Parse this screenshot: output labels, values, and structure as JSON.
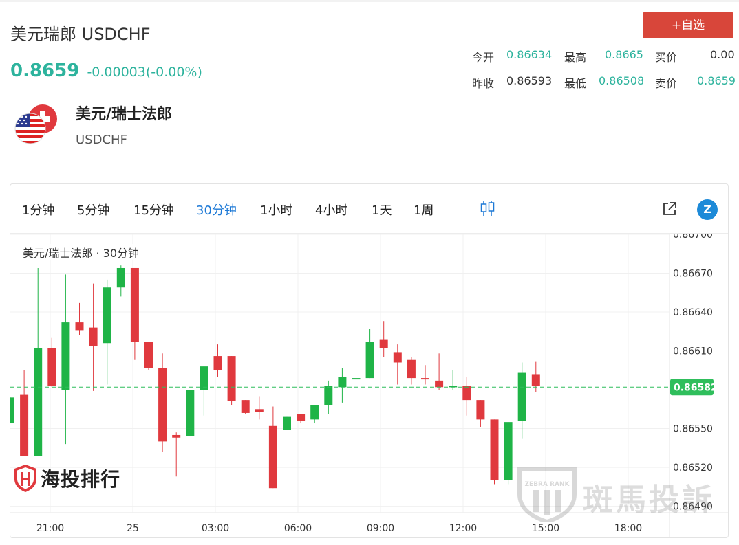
{
  "header": {
    "title": "美元瑞郎 USDCHF",
    "price": "0.8659",
    "change": "-0.00003(-0.00%)",
    "watch_button": "+自选"
  },
  "quote": {
    "open_label": "今开",
    "open_value": "0.86634",
    "high_label": "最高",
    "high_value": "0.8665",
    "bid_label": "买价",
    "bid_value": "0.00",
    "prev_close_label": "昨收",
    "prev_close_value": "0.86593",
    "low_label": "最低",
    "low_value": "0.86508",
    "ask_label": "卖价",
    "ask_value": "0.8659"
  },
  "instrument": {
    "name": "美元/瑞士法郎",
    "code": "USDCHF",
    "icon": "usd-chf-flag-icon"
  },
  "toolbar": {
    "timeframes": [
      "1分钟",
      "5分钟",
      "15分钟",
      "30分钟",
      "1小时",
      "4小时",
      "1天",
      "1周"
    ],
    "active_timeframe": "30分钟",
    "icons": [
      "candlestick-type-icon",
      "popout-icon",
      "z-brand-icon"
    ]
  },
  "chart": {
    "legend": "美元/瑞士法郎 · 30分钟",
    "current_price_label": "0.86582",
    "watermark_left": "海投排行",
    "watermark_right": "斑馬投訴",
    "watermark_right_badge": "ZEBRA RANK"
  },
  "colors": {
    "up": "#1fb447",
    "down": "#e0393e",
    "accent_green": "#2db39d",
    "active_blue": "#1d79d6",
    "button_red": "#d8463a"
  },
  "chart_data": {
    "type": "candlestick",
    "x_tick_labels": [
      "21:00",
      "25",
      "03:00",
      "06:00",
      "09:00",
      "12:00",
      "15:00",
      "18:00"
    ],
    "y_tick_labels": [
      "0.86700",
      "0.86670",
      "0.86640",
      "0.86610",
      "0.86550",
      "0.86520",
      "0.86490"
    ],
    "ylim": [
      0.86485,
      0.867
    ],
    "current_price": 0.86582,
    "grid": true,
    "candles": [
      {
        "o": 0.86554,
        "h": 0.86574,
        "l": 0.86554,
        "c": 0.86574
      },
      {
        "o": 0.86576,
        "h": 0.86595,
        "l": 0.86533,
        "c": 0.86529
      },
      {
        "o": 0.86529,
        "h": 0.86674,
        "l": 0.86529,
        "c": 0.86612
      },
      {
        "o": 0.86612,
        "h": 0.8662,
        "l": 0.86582,
        "c": 0.86583
      },
      {
        "o": 0.8658,
        "h": 0.86669,
        "l": 0.86538,
        "c": 0.86632
      },
      {
        "o": 0.86632,
        "h": 0.86647,
        "l": 0.86622,
        "c": 0.86626
      },
      {
        "o": 0.86628,
        "h": 0.86662,
        "l": 0.86579,
        "c": 0.86614
      },
      {
        "o": 0.86616,
        "h": 0.86665,
        "l": 0.86584,
        "c": 0.86659
      },
      {
        "o": 0.86659,
        "h": 0.86676,
        "l": 0.86652,
        "c": 0.86674
      },
      {
        "o": 0.86674,
        "h": 0.86674,
        "l": 0.86603,
        "c": 0.86617
      },
      {
        "o": 0.86617,
        "h": 0.86617,
        "l": 0.86595,
        "c": 0.86597
      },
      {
        "o": 0.86597,
        "h": 0.86608,
        "l": 0.86532,
        "c": 0.8654
      },
      {
        "o": 0.86545,
        "h": 0.86547,
        "l": 0.86513,
        "c": 0.86543
      },
      {
        "o": 0.86544,
        "h": 0.8658,
        "l": 0.86544,
        "c": 0.8658
      },
      {
        "o": 0.8658,
        "h": 0.86598,
        "l": 0.8656,
        "c": 0.86598
      },
      {
        "o": 0.86606,
        "h": 0.86615,
        "l": 0.8659,
        "c": 0.86595
      },
      {
        "o": 0.86606,
        "h": 0.86606,
        "l": 0.86568,
        "c": 0.86571
      },
      {
        "o": 0.86572,
        "h": 0.86572,
        "l": 0.86561,
        "c": 0.86562
      },
      {
        "o": 0.86565,
        "h": 0.86575,
        "l": 0.86557,
        "c": 0.86563
      },
      {
        "o": 0.86552,
        "h": 0.86567,
        "l": 0.86504,
        "c": 0.86504
      },
      {
        "o": 0.86549,
        "h": 0.86559,
        "l": 0.86552,
        "c": 0.86559
      },
      {
        "o": 0.86561,
        "h": 0.8656,
        "l": 0.86554,
        "c": 0.86556
      },
      {
        "o": 0.86557,
        "h": 0.86566,
        "l": 0.86554,
        "c": 0.86568
      },
      {
        "o": 0.86568,
        "h": 0.86587,
        "l": 0.86561,
        "c": 0.86583
      },
      {
        "o": 0.86582,
        "h": 0.86597,
        "l": 0.8657,
        "c": 0.8659
      },
      {
        "o": 0.86589,
        "h": 0.86608,
        "l": 0.86575,
        "c": 0.86589
      },
      {
        "o": 0.86589,
        "h": 0.86627,
        "l": 0.86589,
        "c": 0.86617
      },
      {
        "o": 0.86619,
        "h": 0.86633,
        "l": 0.86605,
        "c": 0.86612
      },
      {
        "o": 0.86609,
        "h": 0.86615,
        "l": 0.86584,
        "c": 0.86601
      },
      {
        "o": 0.86603,
        "h": 0.86605,
        "l": 0.86584,
        "c": 0.86589
      },
      {
        "o": 0.86589,
        "h": 0.86599,
        "l": 0.86584,
        "c": 0.86588
      },
      {
        "o": 0.86587,
        "h": 0.86608,
        "l": 0.8658,
        "c": 0.86582
      },
      {
        "o": 0.86583,
        "h": 0.86595,
        "l": 0.8658,
        "c": 0.86583
      },
      {
        "o": 0.86583,
        "h": 0.8659,
        "l": 0.8656,
        "c": 0.86572
      },
      {
        "o": 0.86572,
        "h": 0.86572,
        "l": 0.86551,
        "c": 0.86557
      },
      {
        "o": 0.86557,
        "h": 0.86557,
        "l": 0.86507,
        "c": 0.8651
      },
      {
        "o": 0.8651,
        "h": 0.86555,
        "l": 0.86507,
        "c": 0.86555
      },
      {
        "o": 0.86556,
        "h": 0.86601,
        "l": 0.86542,
        "c": 0.86593
      },
      {
        "o": 0.86592,
        "h": 0.86602,
        "l": 0.86578,
        "c": 0.86583
      }
    ]
  }
}
